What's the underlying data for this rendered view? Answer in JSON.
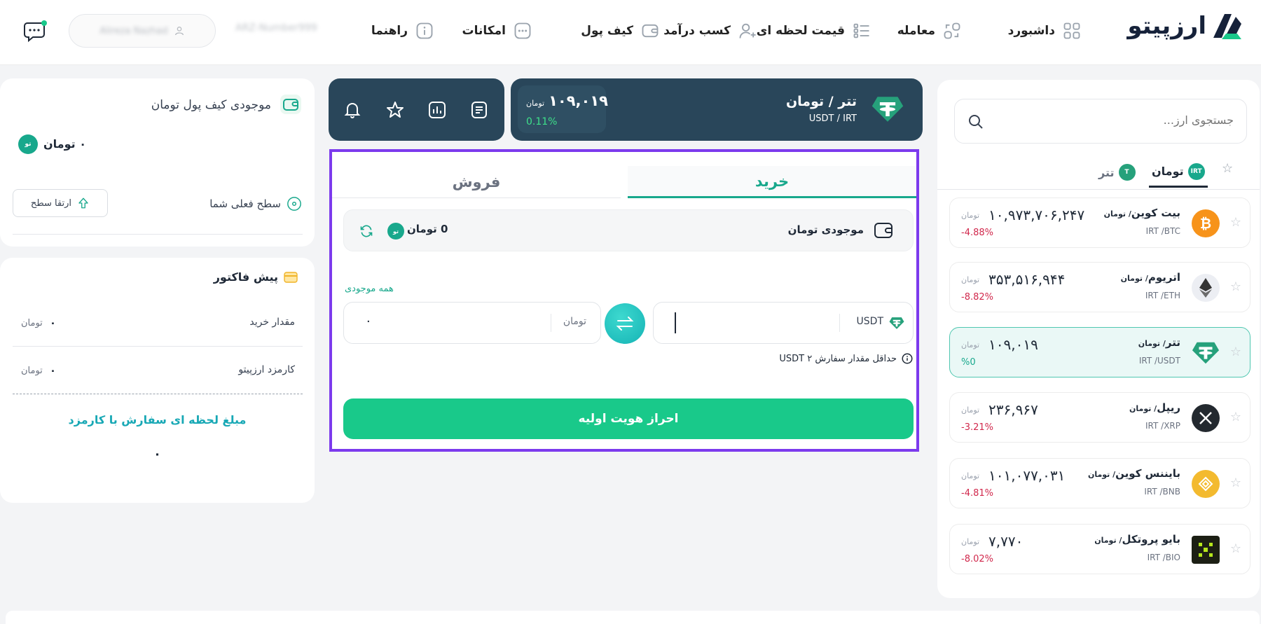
{
  "brand": {
    "name": "ارزپیتو"
  },
  "nav": [
    {
      "label": "داشبورد",
      "icon": "dashboard-icon"
    },
    {
      "label": "معامله",
      "icon": "exchange-icon"
    },
    {
      "label": "قیمت لحظه ای",
      "icon": "list-filter-icon"
    },
    {
      "label": "کسب درآمد",
      "icon": "user-plus-icon"
    },
    {
      "label": "کیف پول",
      "icon": "wallet-icon"
    },
    {
      "label": "امکانات",
      "icon": "dots-icon"
    },
    {
      "label": "راهنما",
      "icon": "info-icon"
    }
  ],
  "user": {
    "name": "Alireza Nazhad",
    "id": "ARZ-Number999"
  },
  "market": {
    "search_placeholder": "جستجوی ارز...",
    "tabs": [
      {
        "label": "تومان",
        "badge": "IRT",
        "active": true
      },
      {
        "label": "تتر",
        "badge": "T",
        "active": false
      }
    ],
    "unit": "تومان",
    "coins": [
      {
        "name": "بیت کوین",
        "quote": "/ تومان",
        "pair": "IRT /BTC",
        "price": "۱۰,۹۷۳,۷۰۶,۲۴۷",
        "change": "-4.88%",
        "icon": "bitcoin-icon",
        "color": "#f7931a",
        "active": false
      },
      {
        "name": "اتریوم",
        "quote": "/ تومان",
        "pair": "IRT /ETH",
        "price": "۳۵۳,۵۱۶,۹۴۴",
        "change": "-8.82%",
        "icon": "ethereum-icon",
        "color": "#e9eaf0",
        "active": false
      },
      {
        "name": "تتر",
        "quote": "/ تومان",
        "pair": "IRT /USDT",
        "price": "۱۰۹,۰۱۹",
        "change": "%0",
        "icon": "tether-icon",
        "color": "#26a17b",
        "active": true
      },
      {
        "name": "ریپل",
        "quote": "/ تومان",
        "pair": "IRT /XRP",
        "price": "۲۳۶,۹۶۷",
        "change": "-3.21%",
        "icon": "ripple-icon",
        "color": "#23292f",
        "active": false
      },
      {
        "name": "بایننس کوین",
        "quote": "/ تومان",
        "pair": "IRT /BNB",
        "price": "۱۰۱,۰۷۷,۰۳۱",
        "change": "-4.81%",
        "icon": "bnb-icon",
        "color": "#f3ba2f",
        "active": false
      },
      {
        "name": "بایو پروتکل",
        "quote": "/ تومان",
        "pair": "IRT /BIO",
        "price": "۷,۷۷۰",
        "change": "-8.02%",
        "icon": "bio-icon",
        "color": "#1c1f14",
        "active": false
      }
    ]
  },
  "ticker": {
    "title": "تتر / تومان",
    "pair": "USDT / IRT",
    "price": "۱۰۹,۰۱۹",
    "unit": "تومان",
    "change": "0.11%"
  },
  "tools": [
    "notification-bell-icon",
    "star-icon",
    "chart-icon",
    "orders-icon"
  ],
  "trade": {
    "tab_buy": "خرید",
    "tab_sell": "فروش",
    "balance_label": "موجودی تومان",
    "balance_value": "0 تومان",
    "all_balance": "همه موجودی",
    "usdt_label": "USDT",
    "toman_label": "تومان",
    "toman_value": "۰",
    "min_order": "حداقل مقدار سفارش USDT ۲",
    "cta": "احراز هویت اولیه"
  },
  "wallet_card": {
    "title": "موجودی کیف پول تومان",
    "balance": "۰ تومان",
    "level_label": "سطح فعلی شما",
    "upgrade": "ارتقا سطح"
  },
  "invoice": {
    "title": "پیش فاکتور",
    "rows": [
      {
        "label": "مقدار خرید",
        "value": "۰",
        "unit": "تومان"
      },
      {
        "label": "کارمزد ارزپیتو",
        "value": "۰",
        "unit": "تومان"
      }
    ],
    "total_label": "مبلغ لحظه ای سفارش با کارمزد",
    "total_value": "۰"
  },
  "colors": {
    "accent": "#19c98a",
    "teal": "#18a88c",
    "dark": "#29465a",
    "highlight": "#7c3aed",
    "negative": "#d1284c"
  }
}
